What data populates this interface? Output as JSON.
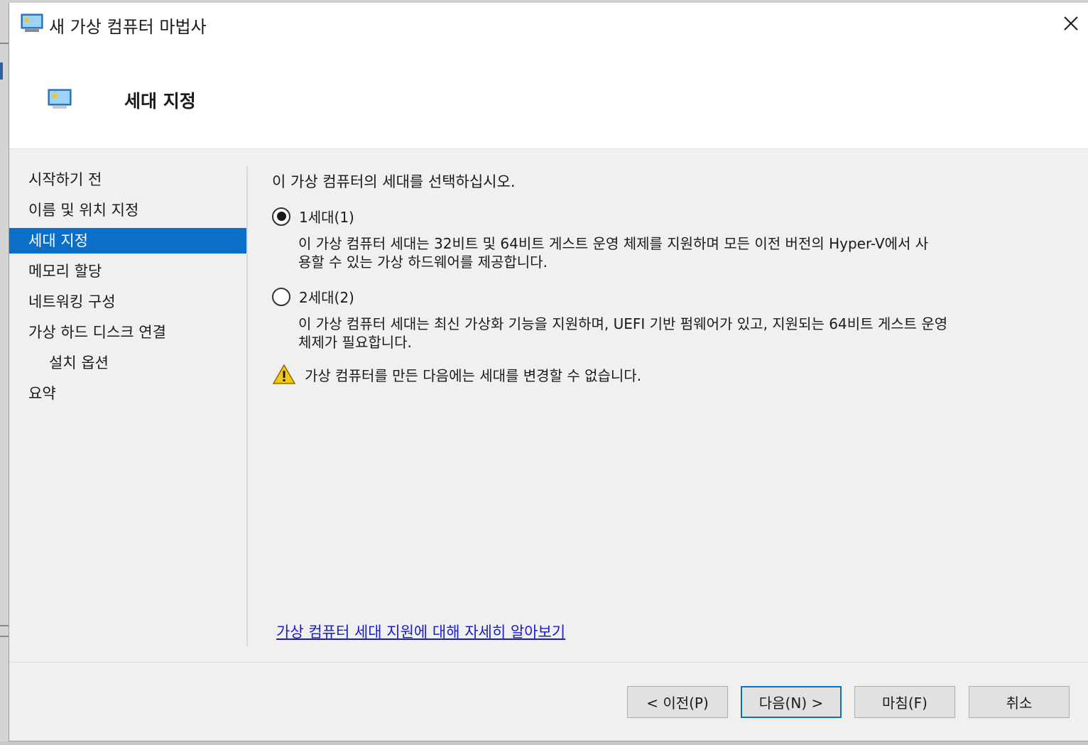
{
  "window": {
    "title": "새 가상 컴퓨터 마법사",
    "icon": "virtual-machine-icon"
  },
  "header": {
    "title": "세대 지정",
    "icon": "virtual-machine-icon"
  },
  "nav": {
    "items": [
      {
        "label": "시작하기 전",
        "selected": false,
        "indent": false
      },
      {
        "label": "이름 및 위치 지정",
        "selected": false,
        "indent": false
      },
      {
        "label": "세대 지정",
        "selected": true,
        "indent": false
      },
      {
        "label": "메모리 할당",
        "selected": false,
        "indent": false
      },
      {
        "label": "네트워킹 구성",
        "selected": false,
        "indent": false
      },
      {
        "label": "가상 하드 디스크 연결",
        "selected": false,
        "indent": false
      },
      {
        "label": "설치 옵션",
        "selected": false,
        "indent": true
      },
      {
        "label": "요약",
        "selected": false,
        "indent": false
      }
    ]
  },
  "content": {
    "prompt": "이 가상 컴퓨터의 세대를 선택하십시오.",
    "gen1": {
      "label": "1세대(1)",
      "checked": true,
      "desc_line1": "이 가상 컴퓨터 세대는 32비트 및 64비트 게스트 운영 체제를 지원하며 모든 이전 버전의 Hyper-V에서 사",
      "desc_line2": "용할 수 있는 가상 하드웨어를 제공합니다."
    },
    "gen2": {
      "label": "2세대(2)",
      "checked": false,
      "desc_line1": "이 가상 컴퓨터 세대는 최신 가상화 기능을 지원하며, UEFI 기반 펌웨어가 있고, 지원되는 64비트 게스트 운영",
      "desc_line2": "체제가 필요합니다."
    },
    "warning": "가상 컴퓨터를 만든 다음에는 세대를 변경할 수 없습니다.",
    "learn_more": "가상 컴퓨터 세대 지원에 대해 자세히 알아보기"
  },
  "buttons": {
    "previous": "< 이전(P)",
    "next": "다음(N) >",
    "finish": "마침(F)",
    "cancel": "취소"
  },
  "colors": {
    "accent": "#0a6fc9",
    "link": "#1a1ad0",
    "warning": "#f2c811"
  }
}
